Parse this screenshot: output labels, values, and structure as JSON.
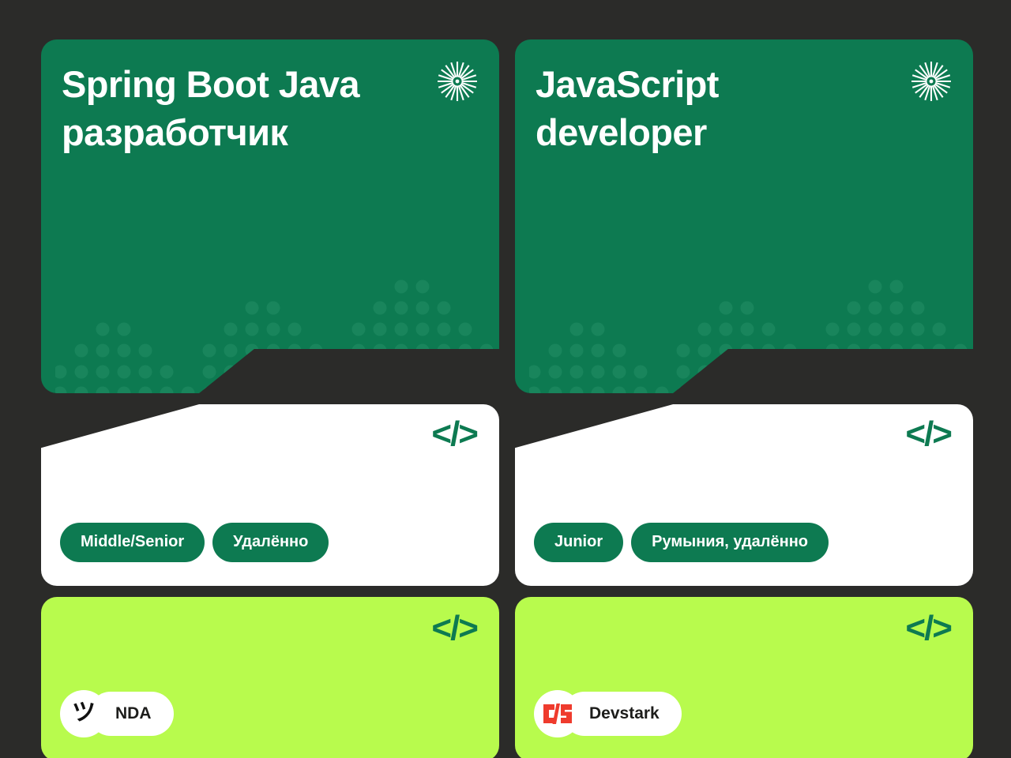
{
  "theme": {
    "background": "#2b2b29",
    "brand_green": "#0d7a51",
    "lime": "#b8fb4d",
    "white": "#ffffff",
    "text_dark": "#1d1d1b",
    "devstark_red": "#ef3b2d"
  },
  "cards": [
    {
      "title": "Spring Boot Java\nразработчик",
      "burst_icon": "starburst-icon",
      "code_icon": "code-brackets-icon",
      "tags": [
        "Middle/Senior",
        "Удалённо"
      ],
      "company": {
        "name": "NDA",
        "logo_icon": "nda-smiley-icon",
        "logo_glyph": "ツ"
      }
    },
    {
      "title": "JavaScript\ndeveloper",
      "burst_icon": "starburst-icon",
      "code_icon": "code-brackets-icon",
      "tags": [
        "Junior",
        "Румыния, удалённо"
      ],
      "company": {
        "name": "Devstark",
        "logo_icon": "devstark-logo-icon",
        "logo_glyph": ""
      }
    }
  ],
  "icons": {
    "code_mark": "</>"
  }
}
